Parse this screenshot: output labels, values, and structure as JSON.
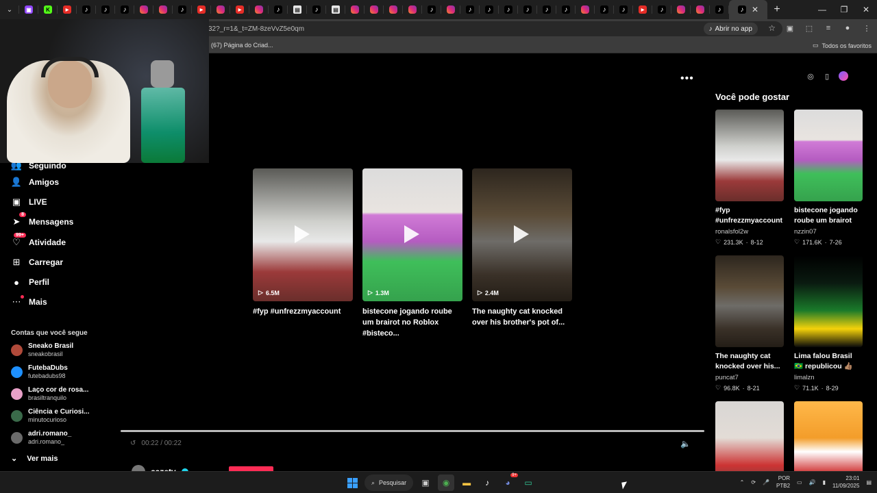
{
  "browser": {
    "tabs": [
      {
        "icon": "twitch-icon",
        "cls": "twitch",
        "glyph": "▣"
      },
      {
        "icon": "kick-icon",
        "cls": "kick",
        "glyph": "K"
      },
      {
        "icon": "youtube-icon",
        "cls": "youtube",
        "glyph": "▶"
      },
      {
        "icon": "tiktok-icon",
        "cls": "tiktok",
        "glyph": "♪"
      },
      {
        "icon": "tiktok-icon",
        "cls": "tiktok",
        "glyph": "♪"
      },
      {
        "icon": "tiktok-icon",
        "cls": "tiktok",
        "glyph": "♪"
      },
      {
        "icon": "instagram-icon",
        "cls": "instagram",
        "glyph": ""
      },
      {
        "icon": "instagram-icon",
        "cls": "instagram",
        "glyph": ""
      },
      {
        "icon": "tiktok-icon",
        "cls": "tiktok",
        "glyph": "♪"
      },
      {
        "icon": "youtube-icon",
        "cls": "youtube",
        "glyph": "▶"
      },
      {
        "icon": "instagram-icon",
        "cls": "instagram",
        "glyph": ""
      },
      {
        "icon": "youtube-icon",
        "cls": "youtube",
        "glyph": "▶"
      },
      {
        "icon": "instagram-icon",
        "cls": "instagram",
        "glyph": ""
      },
      {
        "icon": "tiktok-icon",
        "cls": "tiktok",
        "glyph": "♪"
      },
      {
        "icon": "document-icon",
        "cls": "doc",
        "glyph": "▤"
      },
      {
        "icon": "tiktok-icon",
        "cls": "tiktok",
        "glyph": "♪"
      },
      {
        "icon": "document-icon",
        "cls": "doc",
        "glyph": "▤"
      },
      {
        "icon": "instagram-icon",
        "cls": "instagram",
        "glyph": ""
      },
      {
        "icon": "instagram-icon",
        "cls": "instagram",
        "glyph": ""
      },
      {
        "icon": "instagram-icon",
        "cls": "instagram",
        "glyph": ""
      },
      {
        "icon": "instagram-icon",
        "cls": "instagram",
        "glyph": ""
      },
      {
        "icon": "tiktok-icon",
        "cls": "tiktok",
        "glyph": "♪"
      },
      {
        "icon": "instagram-icon",
        "cls": "instagram",
        "glyph": ""
      },
      {
        "icon": "tiktok-icon",
        "cls": "tiktok",
        "glyph": "♪"
      },
      {
        "icon": "tiktok-icon",
        "cls": "tiktok",
        "glyph": "♪"
      },
      {
        "icon": "tiktok-icon",
        "cls": "tiktok",
        "glyph": "♪"
      },
      {
        "icon": "tiktok-icon",
        "cls": "tiktok",
        "glyph": "♪"
      },
      {
        "icon": "tiktok-icon",
        "cls": "tiktok",
        "glyph": "♪"
      },
      {
        "icon": "tiktok-icon",
        "cls": "tiktok",
        "glyph": "♪"
      },
      {
        "icon": "instagram-icon",
        "cls": "instagram",
        "glyph": ""
      },
      {
        "icon": "tiktok-icon",
        "cls": "tiktok",
        "glyph": "♪"
      },
      {
        "icon": "tiktok-icon",
        "cls": "tiktok",
        "glyph": "♪"
      },
      {
        "icon": "youtube-icon",
        "cls": "youtube",
        "glyph": "▶"
      },
      {
        "icon": "tiktok-icon",
        "cls": "tiktok",
        "glyph": "♪"
      },
      {
        "icon": "instagram-icon",
        "cls": "instagram",
        "glyph": ""
      },
      {
        "icon": "instagram-icon",
        "cls": "instagram",
        "glyph": ""
      },
      {
        "icon": "tiktok-icon",
        "cls": "tiktok",
        "glyph": "♪"
      }
    ],
    "url": "32?_r=1&_t=ZM-8zeVvZ5e0qm",
    "open_app_label": "Abrir no app",
    "bookmark_item": "(67) Página do Criad...",
    "all_bookmarks": "Todos os favoritos"
  },
  "sidebar": {
    "items": [
      {
        "icon": "following-icon",
        "glyph": "👥",
        "label": "Seguindo"
      },
      {
        "icon": "friends-icon",
        "glyph": "👤",
        "label": "Amigos"
      },
      {
        "icon": "live-icon",
        "glyph": "▣",
        "label": "LIVE"
      },
      {
        "icon": "messages-icon",
        "glyph": "➤",
        "label": "Mensagens",
        "badge": "8"
      },
      {
        "icon": "activity-icon",
        "glyph": "♡",
        "label": "Atividade",
        "badge": "99+"
      },
      {
        "icon": "upload-icon",
        "glyph": "⊞",
        "label": "Carregar"
      },
      {
        "icon": "profile-icon",
        "glyph": "●",
        "label": "Perfil"
      },
      {
        "icon": "more-icon",
        "glyph": "⋯",
        "label": "Mais",
        "dot": true
      }
    ],
    "following_title": "Contas que você segue",
    "following": [
      {
        "name": "Sneako Brasil",
        "handle": "sneakobrasil",
        "color": "#b04a3a"
      },
      {
        "name": "FutebaDubs",
        "handle": "futebadubs98",
        "color": "#1e90ff"
      },
      {
        "name": "Laço cor de rosa...",
        "handle": "brasiltranquilo",
        "color": "#e8a0c8"
      },
      {
        "name": "Ciência e Curiosi...",
        "handle": "minutocurioso",
        "color": "#3a6a4a"
      },
      {
        "name": "adri.romano_",
        "handle": "adri.romano_",
        "color": "#6a6a6a"
      }
    ],
    "see_more": "Ver mais"
  },
  "videos": [
    {
      "views": "6.5M",
      "caption": "#fyp #unfrezzmyaccount",
      "thumb": "th-ronaldo"
    },
    {
      "views": "1.3M",
      "caption": "bistecone jogando roube um brairot no Roblox #bisteco...",
      "thumb": "th-roblox"
    },
    {
      "views": "2.4M",
      "caption": "The naughty cat knocked over his brother's pot of...",
      "thumb": "th-cat"
    }
  ],
  "player": {
    "time": "00:22 / 00:22",
    "progress": 1.0,
    "author": "cazetv"
  },
  "recommendations": {
    "title": "Você pode gostar",
    "items": [
      {
        "caption": "#fyp #unfrezzmyaccount",
        "author": "ronalsfol2w",
        "likes": "231.3K",
        "date": "8-12",
        "thumb": "th-ronaldo"
      },
      {
        "caption": "bistecone jogando roube um brairot n...",
        "author": "nzzin07",
        "likes": "171.6K",
        "date": "7-26",
        "thumb": "th-roblox"
      },
      {
        "caption": "The naughty cat knocked over his...",
        "author": "puncat7",
        "likes": "96.8K",
        "date": "8-21",
        "thumb": "th-cat"
      },
      {
        "caption": "Lima falou Brasil 🇧🇷 republicou 👍🏽 pt3...",
        "author": "limalzn",
        "likes": "71.1K",
        "date": "8-29",
        "thumb": "th-brasil"
      },
      {
        "caption": "",
        "author": "",
        "likes": "",
        "date": "",
        "thumb": "th-caze"
      },
      {
        "caption": "",
        "author": "",
        "likes": "",
        "date": "",
        "thumb": "th-cartoon"
      }
    ]
  },
  "taskbar": {
    "search_label": "Pesquisar",
    "lang_top": "POR",
    "lang_bottom": "PTB2",
    "clock_time": "23:01",
    "clock_date": "11/09/2025",
    "discord_badge": "9+"
  },
  "colors": {
    "accent": "#fe2c55",
    "verified": "#20d5ec"
  }
}
